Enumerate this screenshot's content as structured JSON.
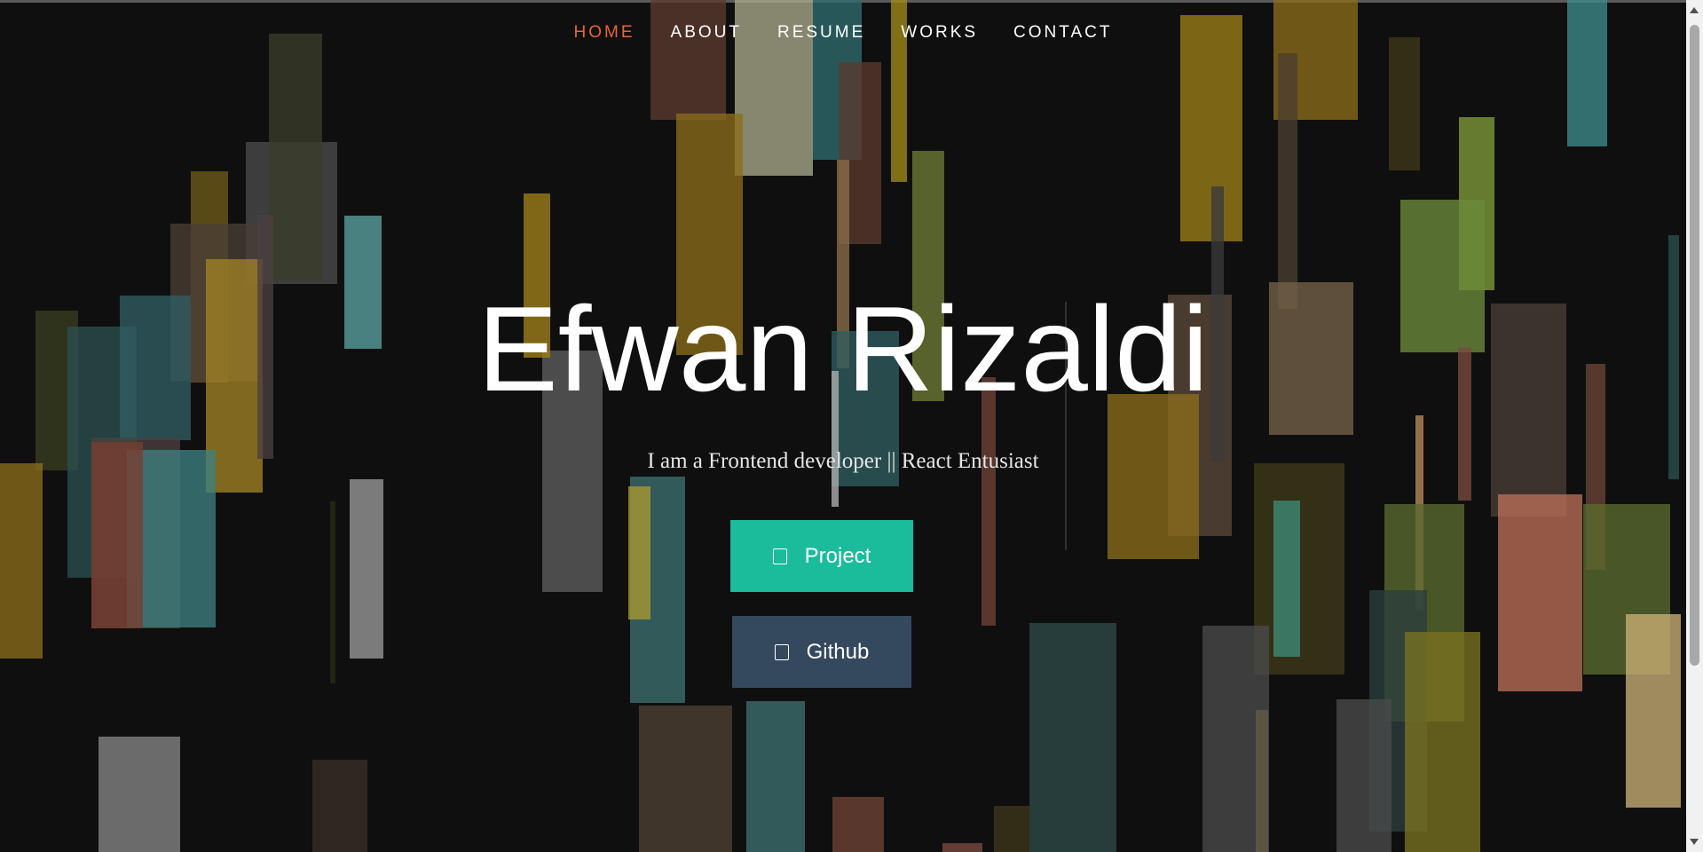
{
  "nav": {
    "items": [
      {
        "label": "HOME",
        "active": true
      },
      {
        "label": "ABOUT",
        "active": false
      },
      {
        "label": "RESUME",
        "active": false
      },
      {
        "label": "WORKS",
        "active": false
      },
      {
        "label": "CONTACT",
        "active": false
      }
    ]
  },
  "hero": {
    "title": "Efwan Rizaldi",
    "subtitle": "I am a Frontend developer || React Entusiast"
  },
  "buttons": {
    "project": {
      "label": "Project",
      "icon": "book-icon"
    },
    "github": {
      "label": "Github",
      "icon": "github-icon"
    }
  },
  "colors": {
    "background": "#0f0f0f",
    "nav_active": "#e8653a",
    "project_button": "#1abc9c",
    "github_button": "#34495e"
  }
}
